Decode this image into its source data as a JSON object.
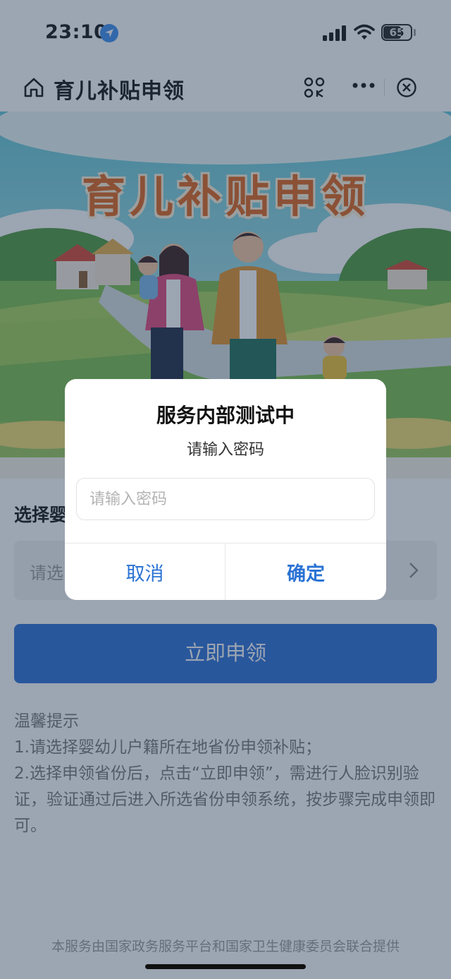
{
  "status_bar": {
    "time": "23:10",
    "battery": "65",
    "battery_level": 0.65,
    "icons": [
      "location-arrow-icon",
      "signal-icon",
      "wifi-icon",
      "battery-icon"
    ]
  },
  "nav": {
    "title": "育儿补贴申领",
    "icons": [
      "home-icon",
      "scan-icon",
      "more-icon",
      "close-icon"
    ]
  },
  "banner": {
    "title": "育儿补贴申领"
  },
  "form": {
    "section_label": "选择婴",
    "select_placeholder": "请选",
    "apply_label": "立即申领"
  },
  "tips": {
    "heading": "温馨提示",
    "line1": "1.请选择婴幼儿户籍所在地省份申领补贴；",
    "line2": "2.选择申领省份后，点击“立即申领”，需进行人脸识别验证，验证通过后进入所选省份申领系统，按步骤完成申领即可。"
  },
  "footer": "本服务由国家政务服务平台和国家卫生健康委员会联合提供",
  "dialog": {
    "title": "服务内部测试中",
    "subtitle": "请输入密码",
    "input_placeholder": "请输入密码",
    "input_value": "",
    "cancel_label": "取消",
    "confirm_label": "确定"
  },
  "colors": {
    "accent": "#2a73d4",
    "primary_button": "#2c6fd6",
    "banner_title": "#e0641a",
    "mask": "rgba(40,58,88,0.46)"
  }
}
